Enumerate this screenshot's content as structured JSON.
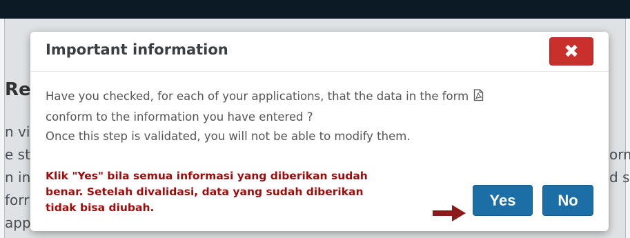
{
  "background": {
    "heading_fragment": "Re",
    "side_fragments_left": [
      "n vi",
      "e st",
      "n in",
      "forr",
      "app"
    ],
    "side_fragments_right": [
      "orm",
      "d s"
    ]
  },
  "modal": {
    "title": "Important information",
    "close_label": "✖",
    "body_line1": "Have you checked, for each of your applications, that the data in the form",
    "body_line2": "conform to the information you have entered ?",
    "body_line3": "Once this step is validated, you will not be able to modify them.",
    "note_line1": "Klik \"Yes\" bila semua informasi yang diberikan sudah",
    "note_line2": "benar. Setelah divalidasi, data yang sudah diberikan",
    "note_line3": "tidak bisa diubah.",
    "yes_label": "Yes",
    "no_label": "No"
  },
  "colors": {
    "close_button": "#c9302c",
    "primary_button": "#1b6fa6",
    "note_text": "#a10b0b",
    "arrow": "#8b1a1a"
  }
}
